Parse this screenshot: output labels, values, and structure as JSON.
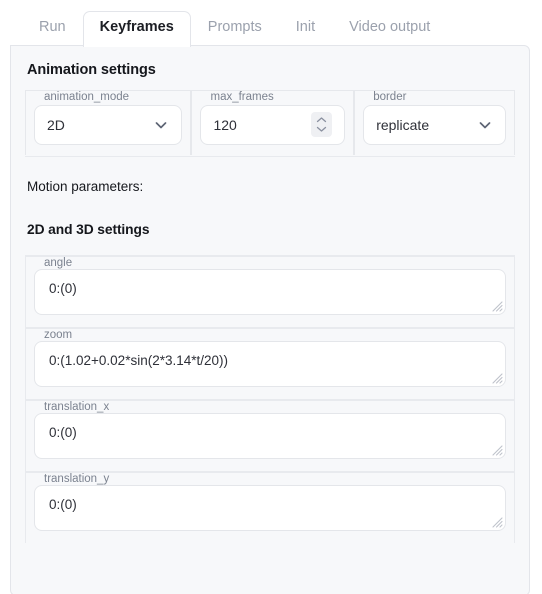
{
  "tabs": [
    {
      "label": "Run",
      "active": false
    },
    {
      "label": "Keyframes",
      "active": true
    },
    {
      "label": "Prompts",
      "active": false
    },
    {
      "label": "Init",
      "active": false
    },
    {
      "label": "Video output",
      "active": false
    }
  ],
  "panel": {
    "heading": "Animation settings",
    "motion_label": "Motion parameters:",
    "subheading": "2D and 3D settings"
  },
  "controls": [
    {
      "name": "animation_mode",
      "legend": "animation_mode",
      "value": "2D",
      "type": "select",
      "icon": "chevron-down-icon"
    },
    {
      "name": "max_frames",
      "legend": "max_frames",
      "value": "120",
      "type": "number",
      "icon": "stepper-icon"
    },
    {
      "name": "border",
      "legend": "border",
      "value": "replicate",
      "type": "select",
      "icon": "chevron-down-icon"
    }
  ],
  "motion_fields": [
    {
      "name": "angle",
      "legend": "angle",
      "value": "0:(0)"
    },
    {
      "name": "zoom",
      "legend": "zoom",
      "value": "0:(1.02+0.02*sin(2*3.14*t/20))"
    },
    {
      "name": "translation_x",
      "legend": "translation_x",
      "value": "0:(0)"
    },
    {
      "name": "translation_y",
      "legend": "translation_y",
      "value": "0:(0)"
    }
  ],
  "colors": {
    "panel_bg": "#f7f8fa",
    "page_bg": "#ffffff",
    "border": "#e3e5ea",
    "input_border": "#e4e6ea",
    "text": "#2e3038",
    "muted_text": "#7b828f",
    "inactive_tab": "#9ba1ad",
    "active_tab": "#1c1e24"
  }
}
